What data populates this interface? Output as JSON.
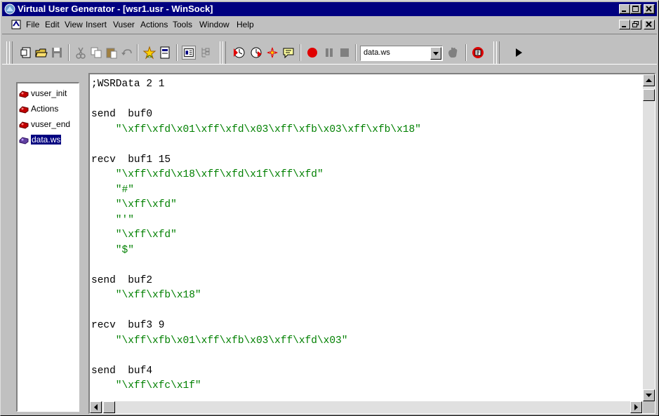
{
  "window": {
    "title": "Virtual User Generator - [wsr1.usr - WinSock]",
    "controls": [
      "minimize",
      "maximize",
      "close"
    ]
  },
  "menu": {
    "items": [
      "File",
      "Edit",
      "View",
      "Insert",
      "Vuser",
      "Actions",
      "Tools",
      "Window",
      "Help"
    ]
  },
  "toolbar": {
    "data_file_combo_value": "data.ws",
    "icons": [
      "new-script-icon",
      "open-icon",
      "save-icon",
      "cut-icon",
      "copy-icon",
      "paste-icon",
      "undo-icon",
      "compile-icon",
      "parameter-icon",
      "script-view-icon",
      "tree-view-icon",
      "start-recording-icon",
      "run-step-icon",
      "breakpoint-icon",
      "comment-icon",
      "record-icon",
      "pause-icon",
      "stop-icon",
      "hand-icon",
      "run-vuser-icon",
      "toolbar-overflow-icon"
    ]
  },
  "tree": {
    "items": [
      {
        "label": "vuser_init",
        "selected": false
      },
      {
        "label": "Actions",
        "selected": false
      },
      {
        "label": "vuser_end",
        "selected": false
      },
      {
        "label": "data.ws",
        "selected": true
      }
    ]
  },
  "editor": {
    "lines": [
      {
        "kw": ";WSRData 2 1",
        "str": ""
      },
      {
        "kw": "",
        "str": ""
      },
      {
        "kw": "send  buf0",
        "str": ""
      },
      {
        "kw": "",
        "str": "    \"\\xff\\xfd\\x01\\xff\\xfd\\x03\\xff\\xfb\\x03\\xff\\xfb\\x18\""
      },
      {
        "kw": "",
        "str": ""
      },
      {
        "kw": "recv  buf1 15",
        "str": ""
      },
      {
        "kw": "",
        "str": "    \"\\xff\\xfd\\x18\\xff\\xfd\\x1f\\xff\\xfd\""
      },
      {
        "kw": "",
        "str": "    \"#\""
      },
      {
        "kw": "",
        "str": "    \"\\xff\\xfd\""
      },
      {
        "kw": "",
        "str": "    \"'\""
      },
      {
        "kw": "",
        "str": "    \"\\xff\\xfd\""
      },
      {
        "kw": "",
        "str": "    \"$\""
      },
      {
        "kw": "",
        "str": ""
      },
      {
        "kw": "send  buf2",
        "str": ""
      },
      {
        "kw": "",
        "str": "    \"\\xff\\xfb\\x18\""
      },
      {
        "kw": "",
        "str": ""
      },
      {
        "kw": "recv  buf3 9",
        "str": ""
      },
      {
        "kw": "",
        "str": "    \"\\xff\\xfb\\x01\\xff\\xfb\\x03\\xff\\xfd\\x03\""
      },
      {
        "kw": "",
        "str": ""
      },
      {
        "kw": "send  buf4",
        "str": ""
      },
      {
        "kw": "",
        "str": "    \"\\xff\\xfc\\x1f\""
      }
    ]
  },
  "colors": {
    "titlebar": "#000080",
    "string_text": "#008000",
    "record_red": "#e00000"
  }
}
